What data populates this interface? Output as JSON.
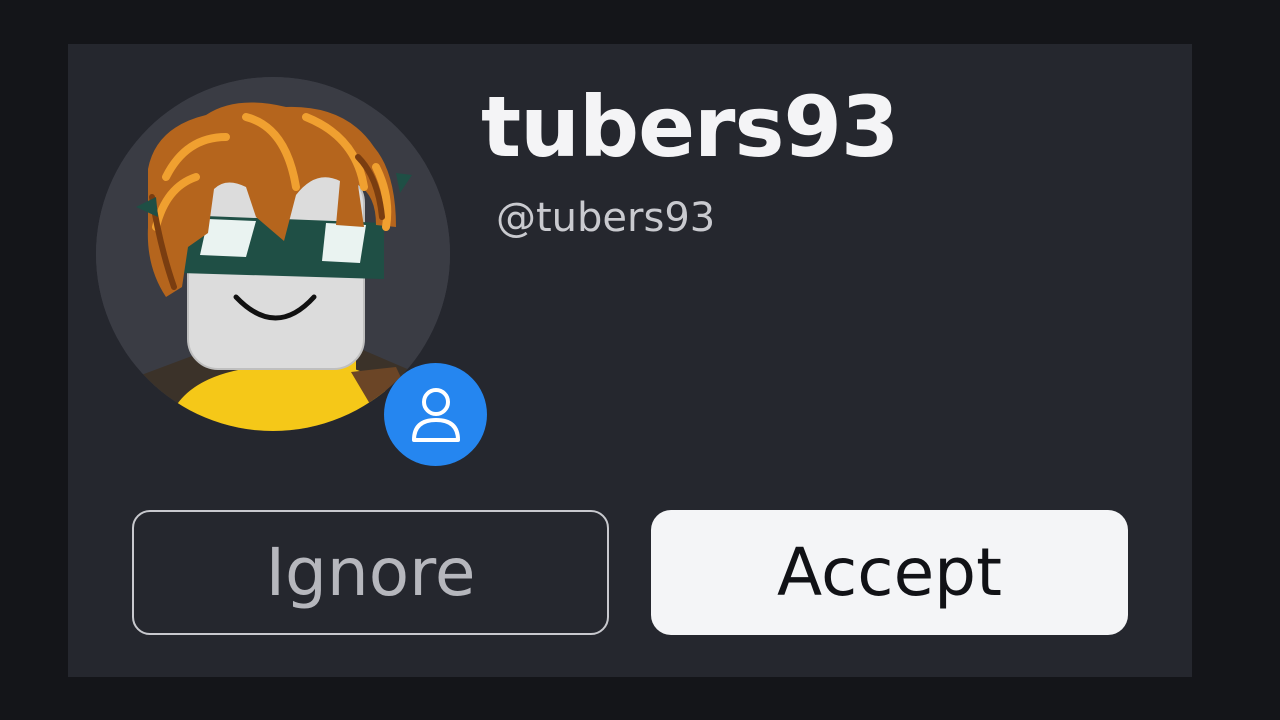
{
  "friend_request": {
    "display_name": "tubers93",
    "username": "@tubers93",
    "badge_icon": "person-icon",
    "badge_color": "#2586f0"
  },
  "actions": {
    "ignore_label": "Ignore",
    "accept_label": "Accept"
  },
  "colors": {
    "background": "#141519",
    "card": "#25272e",
    "accept_bg": "#f4f5f7",
    "ignore_border": "#c8c9ce"
  }
}
